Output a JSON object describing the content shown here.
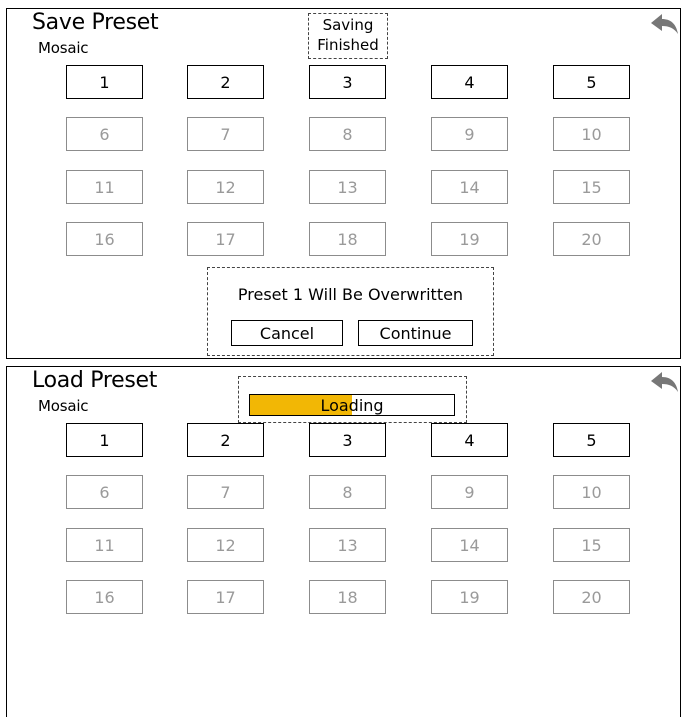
{
  "save_panel": {
    "title": "Save Preset",
    "subtitle": "Mosaic",
    "status_line1": "Saving",
    "status_line2": "Finished",
    "presets": [
      "1",
      "2",
      "3",
      "4",
      "5",
      "6",
      "7",
      "8",
      "9",
      "10",
      "11",
      "12",
      "13",
      "14",
      "15",
      "16",
      "17",
      "18",
      "19",
      "20"
    ],
    "active_presets": 5,
    "dialog": {
      "message": "Preset 1 Will Be Overwritten",
      "cancel_label": "Cancel",
      "continue_label": "Continue"
    }
  },
  "load_panel": {
    "title": "Load Preset",
    "subtitle": "Mosaic",
    "loading_label": "Loading",
    "progress_fraction": 0.5,
    "presets": [
      "1",
      "2",
      "3",
      "4",
      "5",
      "6",
      "7",
      "8",
      "9",
      "10",
      "11",
      "12",
      "13",
      "14",
      "15",
      "16",
      "17",
      "18",
      "19",
      "20"
    ],
    "active_presets": 5
  },
  "icons": {
    "back": "back-arrow-icon"
  },
  "colors": {
    "progress_fill": "#f2b705",
    "back_icon": "#777777",
    "dim_text": "#9a9a9a"
  }
}
